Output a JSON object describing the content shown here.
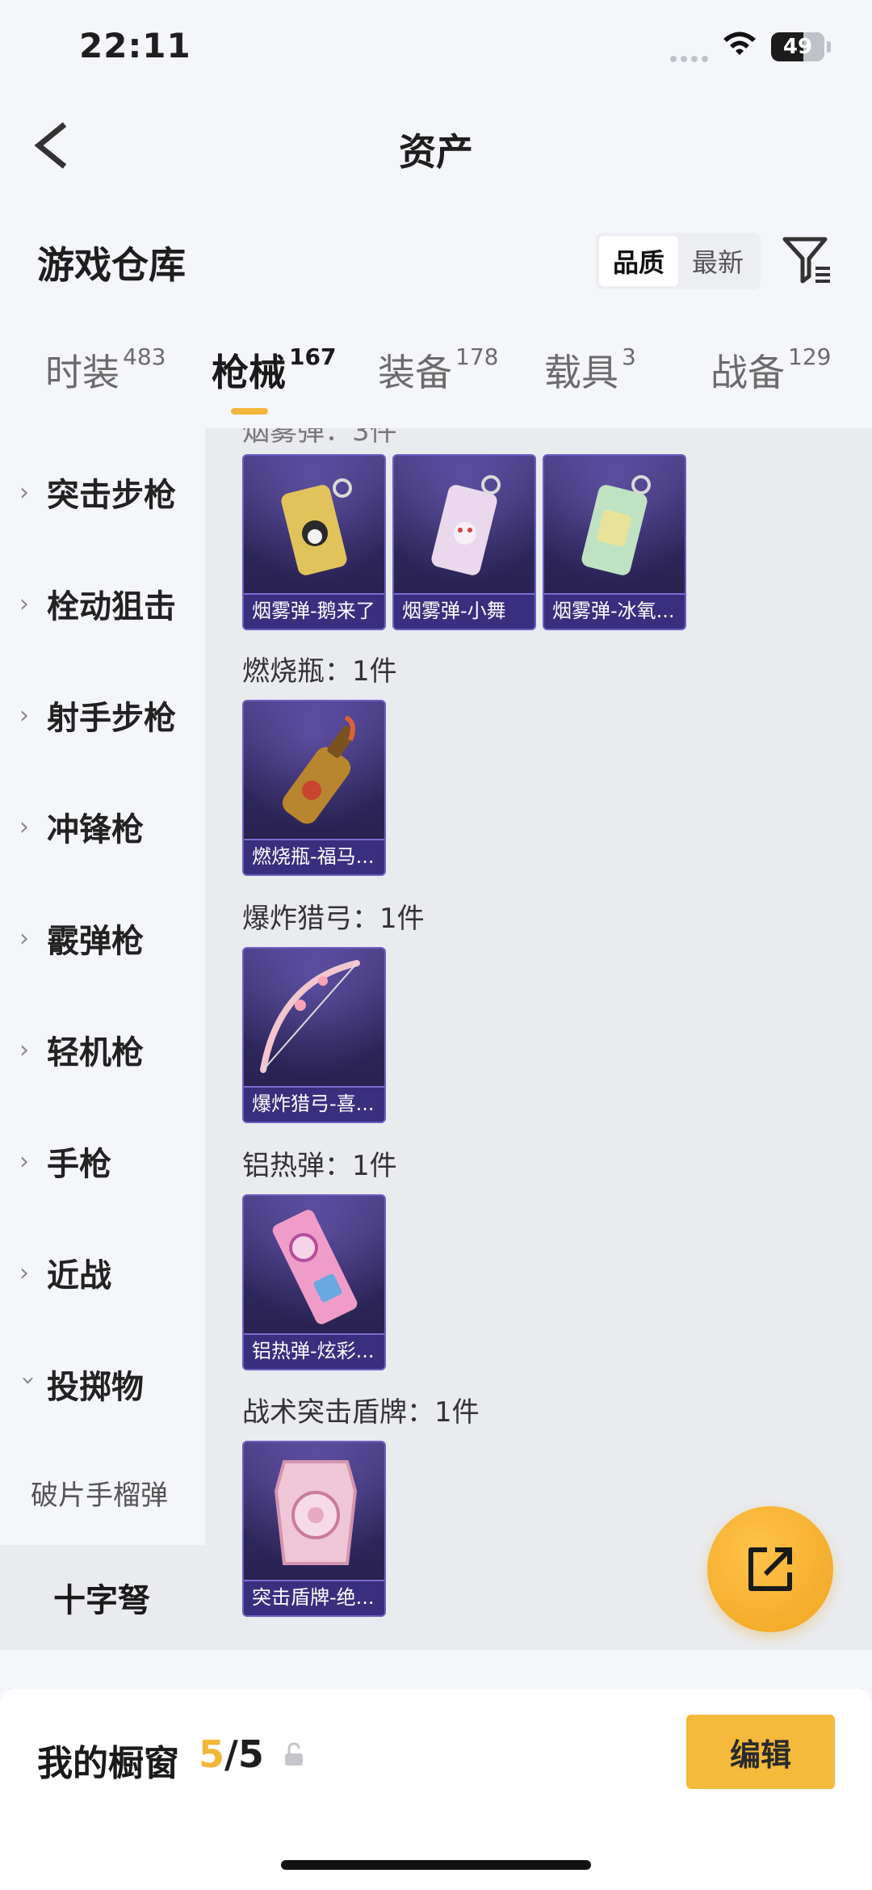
{
  "status_bar": {
    "time": "22:11",
    "battery": "49"
  },
  "nav": {
    "title": "资产"
  },
  "section": {
    "title": "游戏仓库",
    "sort_options": [
      "品质",
      "最新"
    ]
  },
  "tabs": [
    {
      "label": "时装",
      "count": "483"
    },
    {
      "label": "枪械",
      "count": "167"
    },
    {
      "label": "装备",
      "count": "178"
    },
    {
      "label": "载具",
      "count": "3"
    },
    {
      "label": "战备",
      "count": "129"
    }
  ],
  "sidebar": {
    "items": [
      {
        "label": "突击步枪"
      },
      {
        "label": "栓动狙击"
      },
      {
        "label": "射手步枪"
      },
      {
        "label": "冲锋枪"
      },
      {
        "label": "霰弹枪"
      },
      {
        "label": "轻机枪"
      },
      {
        "label": "手枪"
      },
      {
        "label": "近战"
      },
      {
        "label": "投掷物"
      }
    ],
    "sub_items": [
      {
        "label": "破片手榴弹"
      },
      {
        "label": "十字弩"
      }
    ]
  },
  "groups": [
    {
      "title": "",
      "cards": [
        {
          "label": "烟雾弹-鹅来了"
        },
        {
          "label": "烟雾弹-小舞"
        },
        {
          "label": "烟雾弹-冰氧..."
        }
      ]
    },
    {
      "title": "燃烧瓶：1件",
      "cards": [
        {
          "label": "燃烧瓶-福马..."
        }
      ]
    },
    {
      "title": "爆炸猎弓：1件",
      "cards": [
        {
          "label": "爆炸猎弓-喜..."
        }
      ]
    },
    {
      "title": "铝热弹：1件",
      "cards": [
        {
          "label": "铝热弹-炫彩..."
        }
      ]
    },
    {
      "title": "战术突击盾牌：1件",
      "cards": [
        {
          "label": "突击盾牌-绝..."
        }
      ]
    }
  ],
  "bottom": {
    "showcase_label": "我的橱窗",
    "showcase_current": "5",
    "showcase_total": "/5",
    "edit_label": "编辑"
  },
  "colors": {
    "accent": "#f2b63c",
    "card_bg": "#2d2659",
    "card_border": "#6c5fc0",
    "content_bg": "#e9ebef"
  }
}
